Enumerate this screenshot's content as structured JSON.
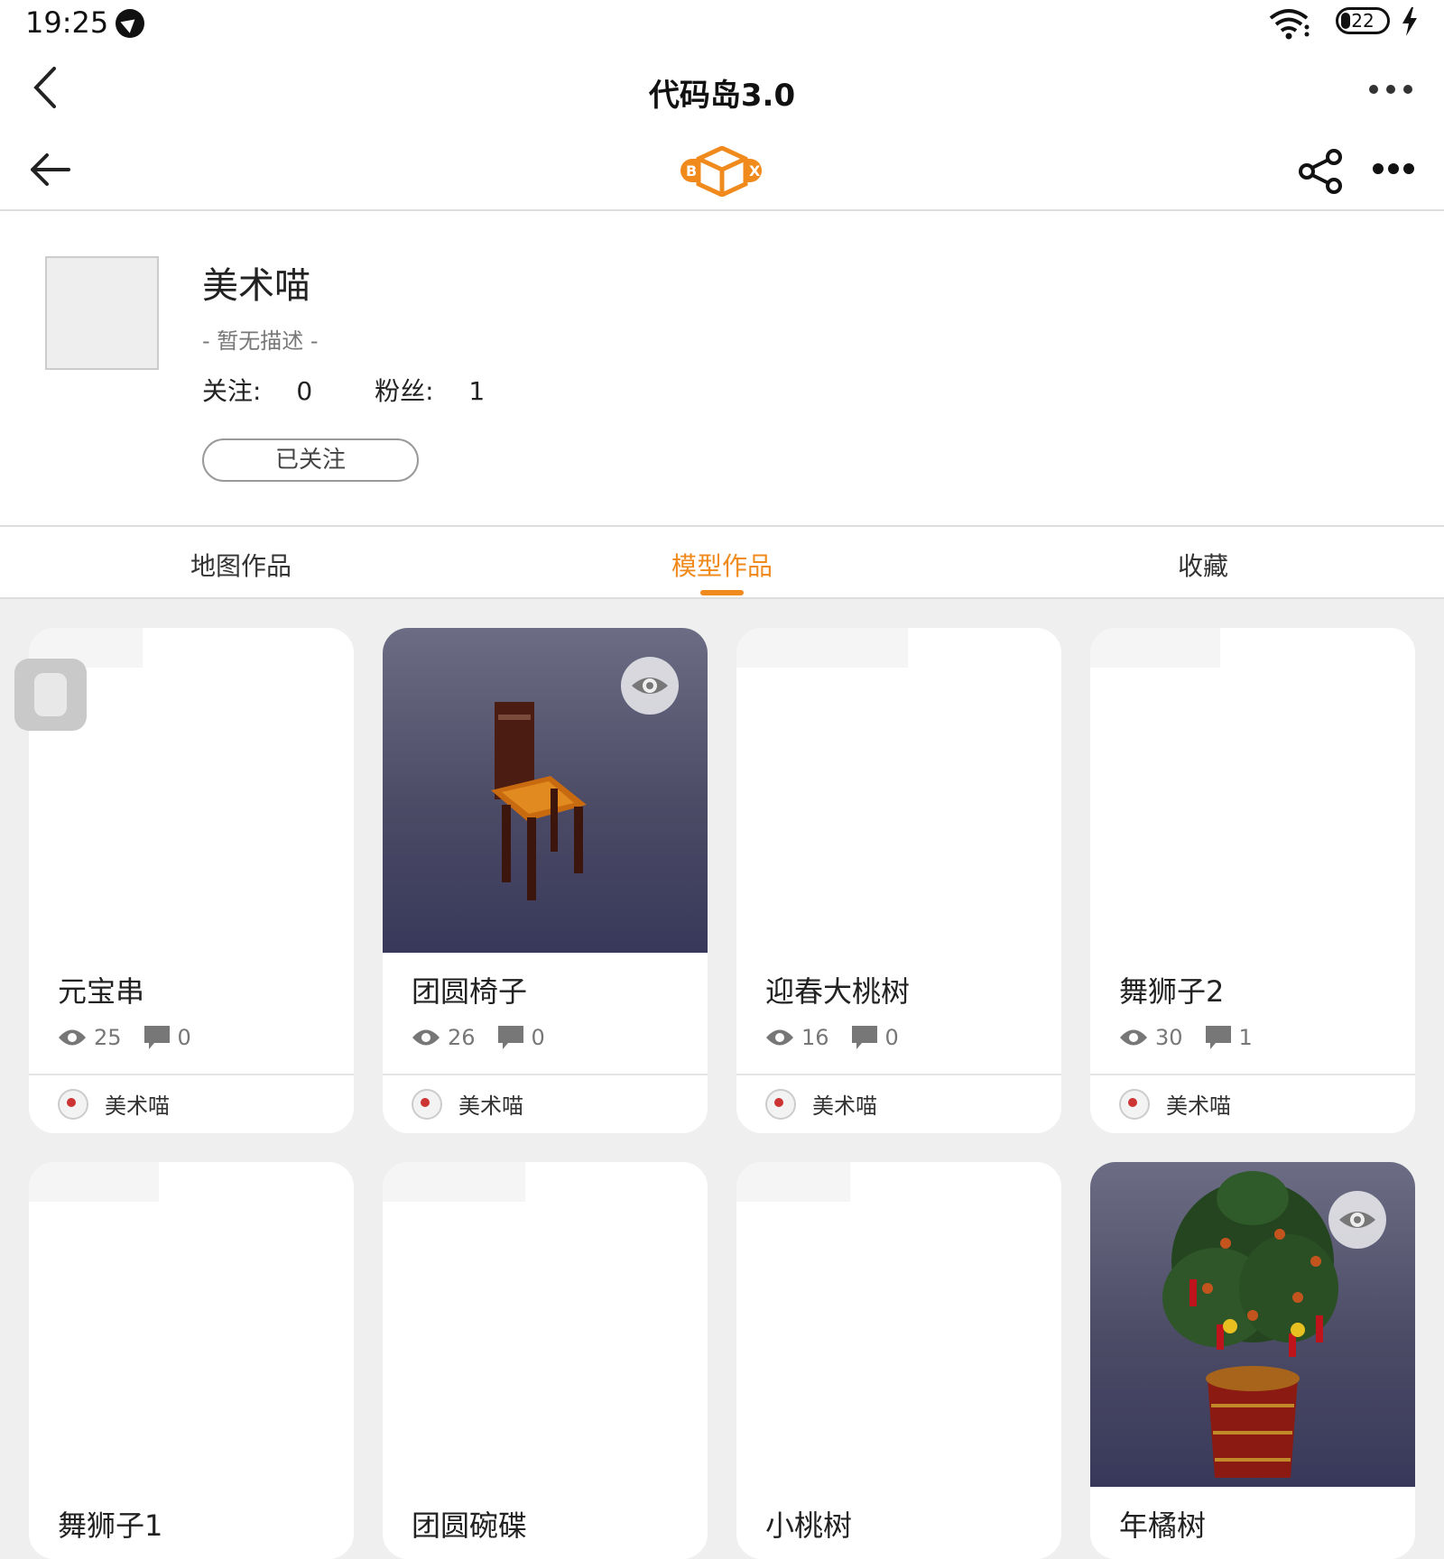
{
  "status_bar": {
    "time": "19:25",
    "battery": "22"
  },
  "title_bar": {
    "title": "代码岛3.0"
  },
  "profile": {
    "name": "美术喵",
    "description": "- 暂无描述 -",
    "following_label": "关注:",
    "following_count": "0",
    "fans_label": "粉丝:",
    "fans_count": "1",
    "follow_button": "已关注"
  },
  "tabs": [
    {
      "label": "地图作品",
      "active": false
    },
    {
      "label": "模型作品",
      "active": true
    },
    {
      "label": "收藏",
      "active": false
    }
  ],
  "accent_color": "#f08a1c",
  "logo": {
    "letters": "B X"
  },
  "works": [
    {
      "title": "元宝串",
      "views": "25",
      "comments": "0",
      "author": "美术喵",
      "thumb": "blank"
    },
    {
      "title": "团圆椅子",
      "views": "26",
      "comments": "0",
      "author": "美术喵",
      "thumb": "chair"
    },
    {
      "title": "迎春大桃树",
      "views": "16",
      "comments": "0",
      "author": "美术喵",
      "thumb": "blank"
    },
    {
      "title": "舞狮子2",
      "views": "30",
      "comments": "1",
      "author": "美术喵",
      "thumb": "blank"
    },
    {
      "title": "舞狮子1",
      "thumb": "blank"
    },
    {
      "title": "团圆碗碟",
      "thumb": "blank"
    },
    {
      "title": "小桃树",
      "thumb": "blank"
    },
    {
      "title": "年橘树",
      "thumb": "tree"
    }
  ]
}
